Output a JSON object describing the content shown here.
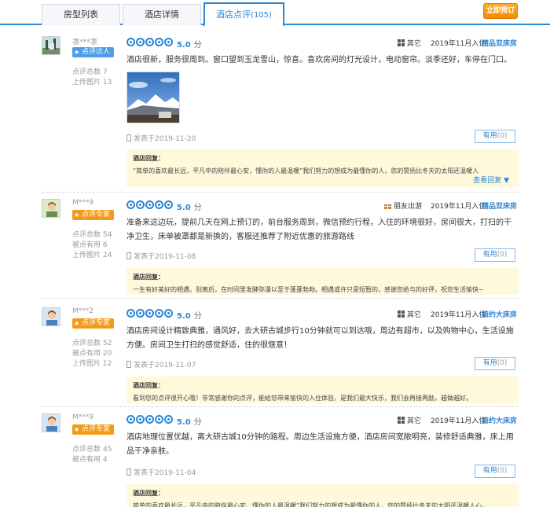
{
  "tabs": [
    {
      "label": "房型列表"
    },
    {
      "label": "酒店详情"
    },
    {
      "label": "酒店点评",
      "count": "(105)"
    }
  ],
  "book_button": "立即预订",
  "score_unit": "分",
  "useful_label": "有用",
  "reply_title": "酒店回复：",
  "reviews": [
    {
      "user": "凛***凛",
      "badge": "点评达人",
      "stats": [
        "点评总数 7",
        "上传图片 13"
      ],
      "score": "5.0",
      "trip": "其它",
      "checkin": "2019年11月入住",
      "room": "精品双床房",
      "content": "酒店很新，服务很周到。窗口望到玉龙雪山，惊喜。喜欢房间的灯光设计，电动窗帘。淡季还好，车停在门口。",
      "posted": "发表于2019-11-20",
      "useful_count": "(0)",
      "reply": "“简单的喜欢最长远，平凡中的陪伴最心安，懂你的人最温暖”我们努力的想成为最懂你的人，您的赞扬比冬天的太阳还温暖人",
      "more": "查看回复"
    },
    {
      "user": "M***9",
      "badge": "点评专家",
      "stats": [
        "点评总数 54",
        "被点有用 6",
        "上传图片 24"
      ],
      "score": "5.0",
      "trip": "朋友出游",
      "checkin": "2019年11月入住",
      "room": "精品双床房",
      "content": "准备来这边玩，提前几天在网上预订的，前台服务周到，微信预约行程，入住的环境很好，房间很大，打扫的干净卫生，床单被罩都是新换的，客服还推荐了附近优惠的旅游路线",
      "posted": "发表于2019-11-08",
      "useful_count": "(0)",
      "reply": "一生有好美好的相遇，别离后，在时间里发酵弥漫以至于蓬蓬勃勃。相遇或许只是短暂的，感谢您给与的好评，祝您生活愉快~"
    },
    {
      "user": "M***2",
      "badge": "点评专家",
      "stats": [
        "点评总数 52",
        "被点有用 20",
        "上传图片 12"
      ],
      "score": "5.0",
      "trip": "其它",
      "checkin": "2019年11月入住",
      "room": "简约大床房",
      "content": "酒店房间设计精致典雅，通风好，去大研古城步行10分钟就可以到达哦，周边有超市，以及购物中心，生活设施方便。房间卫生打扫的感觉舒适，住的很惬意！",
      "posted": "发表于2019-11-07",
      "useful_count": "(0)",
      "reply": "看到您的点评很开心哦！非常感谢你的点评，能给您带来愉快的入住体验，是我们最大快乐，我们会再接再励，越做越好。"
    },
    {
      "user": "M***9",
      "badge": "点评专家",
      "stats": [
        "点评总数 45",
        "被点有用 4"
      ],
      "score": "5.0",
      "trip": "其它",
      "checkin": "2019年11月入住",
      "room": "简约大床房",
      "content": "酒店地理位置优越，离大研古城10分钟的路程。周边生活设施方便，酒店房间宽敞明亮，装修舒适典雅，床上用品干净亲肤。",
      "posted": "发表于2019-11-04",
      "useful_count": "(0)",
      "reply": "简单的喜欢最长远，平凡中的陪伴最心安，懂你的人最温暖”我们努力的想成为最懂你的人，您的赞扬比冬天的太阳还温暖人心，"
    }
  ]
}
